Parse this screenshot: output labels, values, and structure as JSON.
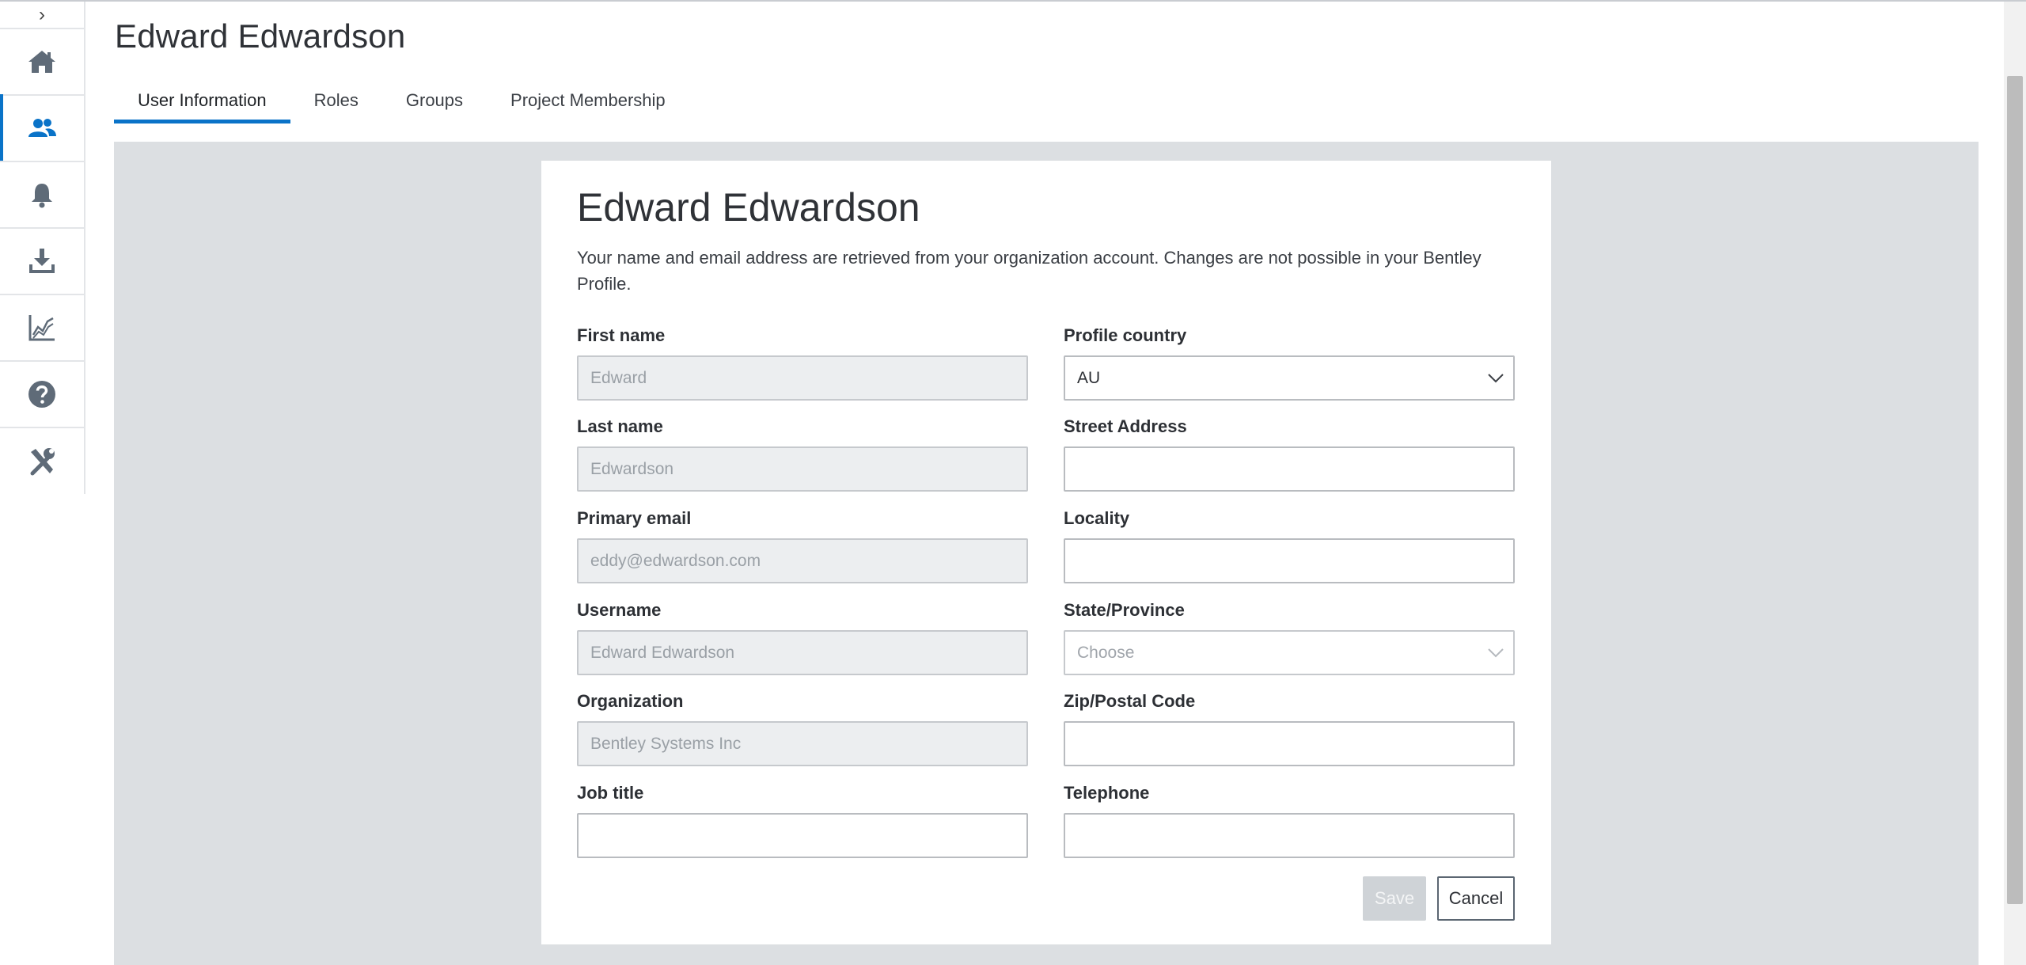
{
  "sidebar": {
    "toggle_icon": "chevron-right-icon",
    "items": [
      {
        "icon": "home-icon"
      },
      {
        "icon": "users-icon",
        "active": true
      },
      {
        "icon": "bell-icon"
      },
      {
        "icon": "download-icon"
      },
      {
        "icon": "chart-line-icon"
      },
      {
        "icon": "help-icon"
      },
      {
        "icon": "tools-icon"
      }
    ]
  },
  "header": {
    "title": "Edward Edwardson"
  },
  "tabs": [
    {
      "label": "User Information",
      "active": true
    },
    {
      "label": "Roles"
    },
    {
      "label": "Groups"
    },
    {
      "label": "Project Membership"
    }
  ],
  "card": {
    "title": "Edward Edwardson",
    "description": "Your name and email address are retrieved from your organization account. Changes are not possible in your Bentley Profile."
  },
  "form": {
    "first_name": {
      "label": "First name",
      "value": "Edward"
    },
    "last_name": {
      "label": "Last name",
      "value": "Edwardson"
    },
    "primary_email": {
      "label": "Primary email",
      "value": "eddy@edwardson.com"
    },
    "username": {
      "label": "Username",
      "value": "Edward Edwardson"
    },
    "organization": {
      "label": "Organization",
      "value": "Bentley Systems Inc"
    },
    "job_title": {
      "label": "Job title",
      "value": ""
    },
    "profile_country": {
      "label": "Profile country",
      "value": "AU"
    },
    "street_address": {
      "label": "Street Address",
      "value": ""
    },
    "locality": {
      "label": "Locality",
      "value": ""
    },
    "state_province": {
      "label": "State/Province",
      "placeholder": "Choose"
    },
    "zip_postal_code": {
      "label": "Zip/Postal Code",
      "value": ""
    },
    "telephone": {
      "label": "Telephone",
      "value": ""
    }
  },
  "actions": {
    "save_label": "Save",
    "cancel_label": "Cancel"
  },
  "colors": {
    "accent": "#0a73c8",
    "sidebar_icon": "#5f6b78",
    "content_background": "#dcdfe2",
    "disabled_field": "#eceef0"
  }
}
